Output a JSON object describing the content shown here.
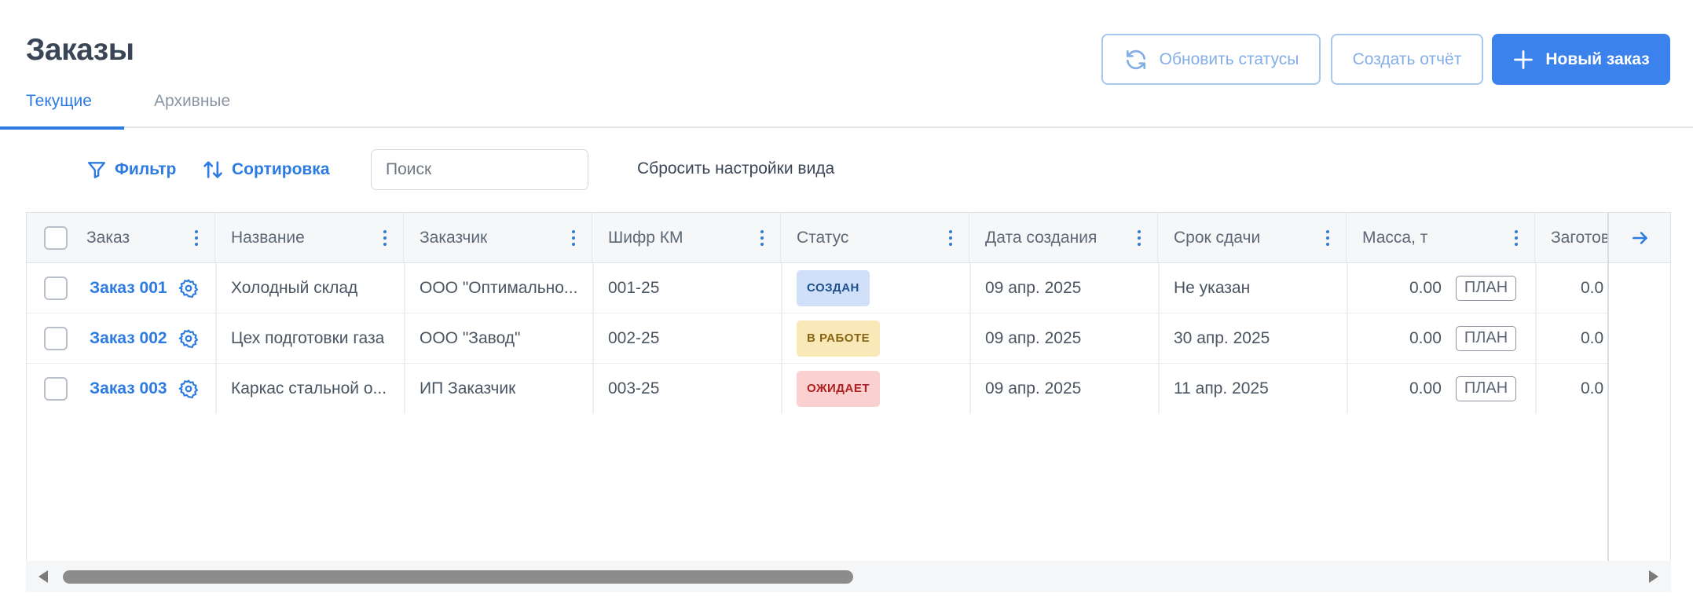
{
  "page": {
    "title": "Заказы"
  },
  "tabs": [
    {
      "label": "Текущие",
      "active": true
    },
    {
      "label": "Архивные",
      "active": false
    }
  ],
  "actions": {
    "refresh_label": "Обновить статусы",
    "report_label": "Создать отчёт",
    "new_label": "Новый заказ"
  },
  "toolbar": {
    "filter_label": "Фильтр",
    "sort_label": "Сортировка",
    "search_placeholder": "Поиск",
    "reset_label": "Сбросить настройки вида"
  },
  "table": {
    "columns": [
      "Заказ",
      "Название",
      "Заказчик",
      "Шифр КМ",
      "Статус",
      "Дата создания",
      "Срок сдачи",
      "Масса, т",
      "Заготов"
    ],
    "rows": [
      {
        "order": "Заказ 001",
        "name": "Холодный склад",
        "customer": "ООО \"Оптимально...",
        "code": "001-25",
        "status": "СОЗДАН",
        "created": "09 апр. 2025",
        "due": "Не указан",
        "mass": "0.00",
        "plan": "ПЛАН",
        "prep": "0.0"
      },
      {
        "order": "Заказ 002",
        "name": "Цех подготовки газа",
        "customer": "ООО \"Завод\"",
        "code": "002-25",
        "status": "В РАБОТЕ",
        "created": "09 апр. 2025",
        "due": "30 апр. 2025",
        "mass": "0.00",
        "plan": "ПЛАН",
        "prep": "0.0"
      },
      {
        "order": "Заказ 003",
        "name": "Каркас стальной о...",
        "customer": "ИП Заказчик",
        "code": "003-25",
        "status": "ОЖИДАЕТ",
        "created": "09 апр. 2025",
        "due": "11 апр. 2025",
        "mass": "0.00",
        "plan": "ПЛАН",
        "prep": "0.0"
      }
    ]
  },
  "status_colors": {
    "СОЗДАН": {
      "bg": "#cfe0f8",
      "fg": "#1f4f8f"
    },
    "В РАБОТЕ": {
      "bg": "#f9e8b8",
      "fg": "#8a6412"
    },
    "ОЖИДАЕТ": {
      "bg": "#fbd0d0",
      "fg": "#b02020"
    }
  },
  "colors": {
    "accent": "#2d7be0",
    "primary_button": "#3b82ec"
  },
  "icons": [
    "refresh-icon",
    "plus-icon",
    "filter-icon",
    "sort-icon",
    "gear-icon",
    "kebab-icon",
    "arrow-right-icon"
  ]
}
